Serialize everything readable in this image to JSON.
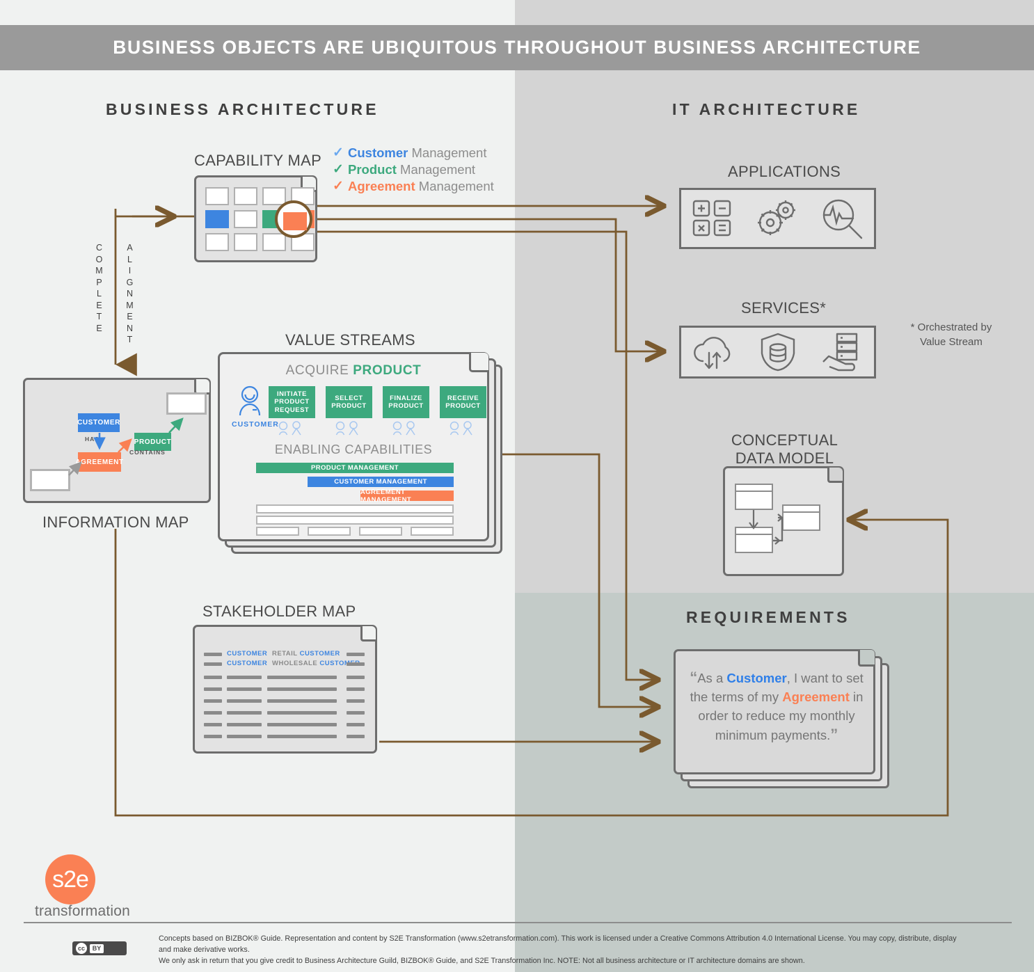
{
  "title": "BUSINESS OBJECTS ARE UBIQUITOUS THROUGHOUT BUSINESS ARCHITECTURE",
  "sections": {
    "business_architecture": "BUSINESS ARCHITECTURE",
    "it_architecture": "IT ARCHITECTURE",
    "requirements": "REQUIREMENTS"
  },
  "colors": {
    "customer": "#3d85e0",
    "product": "#3da97e",
    "agreement": "#fa8054",
    "arrow": "#7a5a2f",
    "title_bar": "#9a9a9a",
    "left_panel": "#f0f2f1",
    "right_panel": "#d4d4d4",
    "requirements_panel": "#c3cbc8"
  },
  "capability_map": {
    "label": "CAPABILITY MAP",
    "highlighted_cells": [
      "blue",
      "green",
      "orange"
    ]
  },
  "legend": [
    {
      "icon": "check-icon",
      "object": "Customer",
      "suffix": " Management",
      "color": "#3d85e0"
    },
    {
      "icon": "check-icon",
      "object": "Product",
      "suffix": " Management",
      "color": "#3da97e"
    },
    {
      "icon": "check-icon",
      "object": "Agreement",
      "suffix": " Management",
      "color": "#fa8054"
    }
  ],
  "connector_labels": {
    "complete": "COMPLETE",
    "alignment": "ALIGNMENT"
  },
  "information_map": {
    "label": "INFORMATION MAP",
    "entities": [
      {
        "name": "CUSTOMER",
        "color": "#3d85e0"
      },
      {
        "name": "AGREEMENT",
        "color": "#fa8054"
      },
      {
        "name": "PRODUCT",
        "color": "#3da97e"
      }
    ],
    "relations": [
      "HAS",
      "CONTAINS"
    ]
  },
  "value_streams": {
    "label": "VALUE STREAMS",
    "stream_title_prefix": "ACQUIRE ",
    "stream_title_object": "PRODUCT",
    "actor": "CUSTOMER",
    "stages": [
      "INITIATE PRODUCT REQUEST",
      "SELECT PRODUCT",
      "FINALIZE PRODUCT",
      "RECEIVE PRODUCT"
    ],
    "enabling_capabilities_label": "ENABLING CAPABILITIES",
    "enabling_capabilities": [
      {
        "label": "PRODUCT MANAGEMENT",
        "color": "#3da97e"
      },
      {
        "label": "CUSTOMER MANAGEMENT",
        "color": "#3d85e0"
      },
      {
        "label": "AGREEMENT MANAGEMENT",
        "color": "#fa8054"
      }
    ]
  },
  "stakeholder_map": {
    "label": "STAKEHOLDER MAP",
    "rows": [
      {
        "col1": "CUSTOMER",
        "col2_prefix": "RETAIL ",
        "col2_object": "CUSTOMER"
      },
      {
        "col1": "CUSTOMER",
        "col2_prefix": "WHOLESALE ",
        "col2_object": "CUSTOMER"
      }
    ]
  },
  "applications": {
    "label": "APPLICATIONS",
    "icons": [
      "apps-grid-icon",
      "gears-icon",
      "analytics-search-icon"
    ]
  },
  "services": {
    "label": "SERVICES*",
    "footnote": "* Orchestrated by\nValue Stream",
    "footnote_line1": "* Orchestrated by",
    "footnote_line2": "Value Stream",
    "icons": [
      "cloud-sync-icon",
      "database-shield-icon",
      "server-hand-icon"
    ]
  },
  "conceptual_data_model": {
    "label_line1": "CONCEPTUAL",
    "label_line2": "DATA MODEL"
  },
  "requirement_card": {
    "open_quote": "“",
    "part1": "As a ",
    "customer": "Customer",
    "part2": ", I want to set the terms of my ",
    "agreement": "Agreement",
    "part3": " in order to reduce my monthly minimum payments.",
    "close_quote": "”"
  },
  "logo": {
    "mark": "s2e",
    "word": "transformation"
  },
  "footer": {
    "badge_cc": "cc",
    "badge_by": "BY",
    "line1": "Concepts based on BIZBOK® Guide. Representation and content by S2E Transformation (www.s2etransformation.com). This work is licensed under a Creative Commons Attribution 4.0 International License. You may copy, distribute, display and make derivative works.",
    "line2": "We only ask in return that you give credit to Business Architecture Guild, BIZBOK® Guide, and S2E Transformation Inc. NOTE: Not all business architecture or IT architecture domains are shown."
  }
}
